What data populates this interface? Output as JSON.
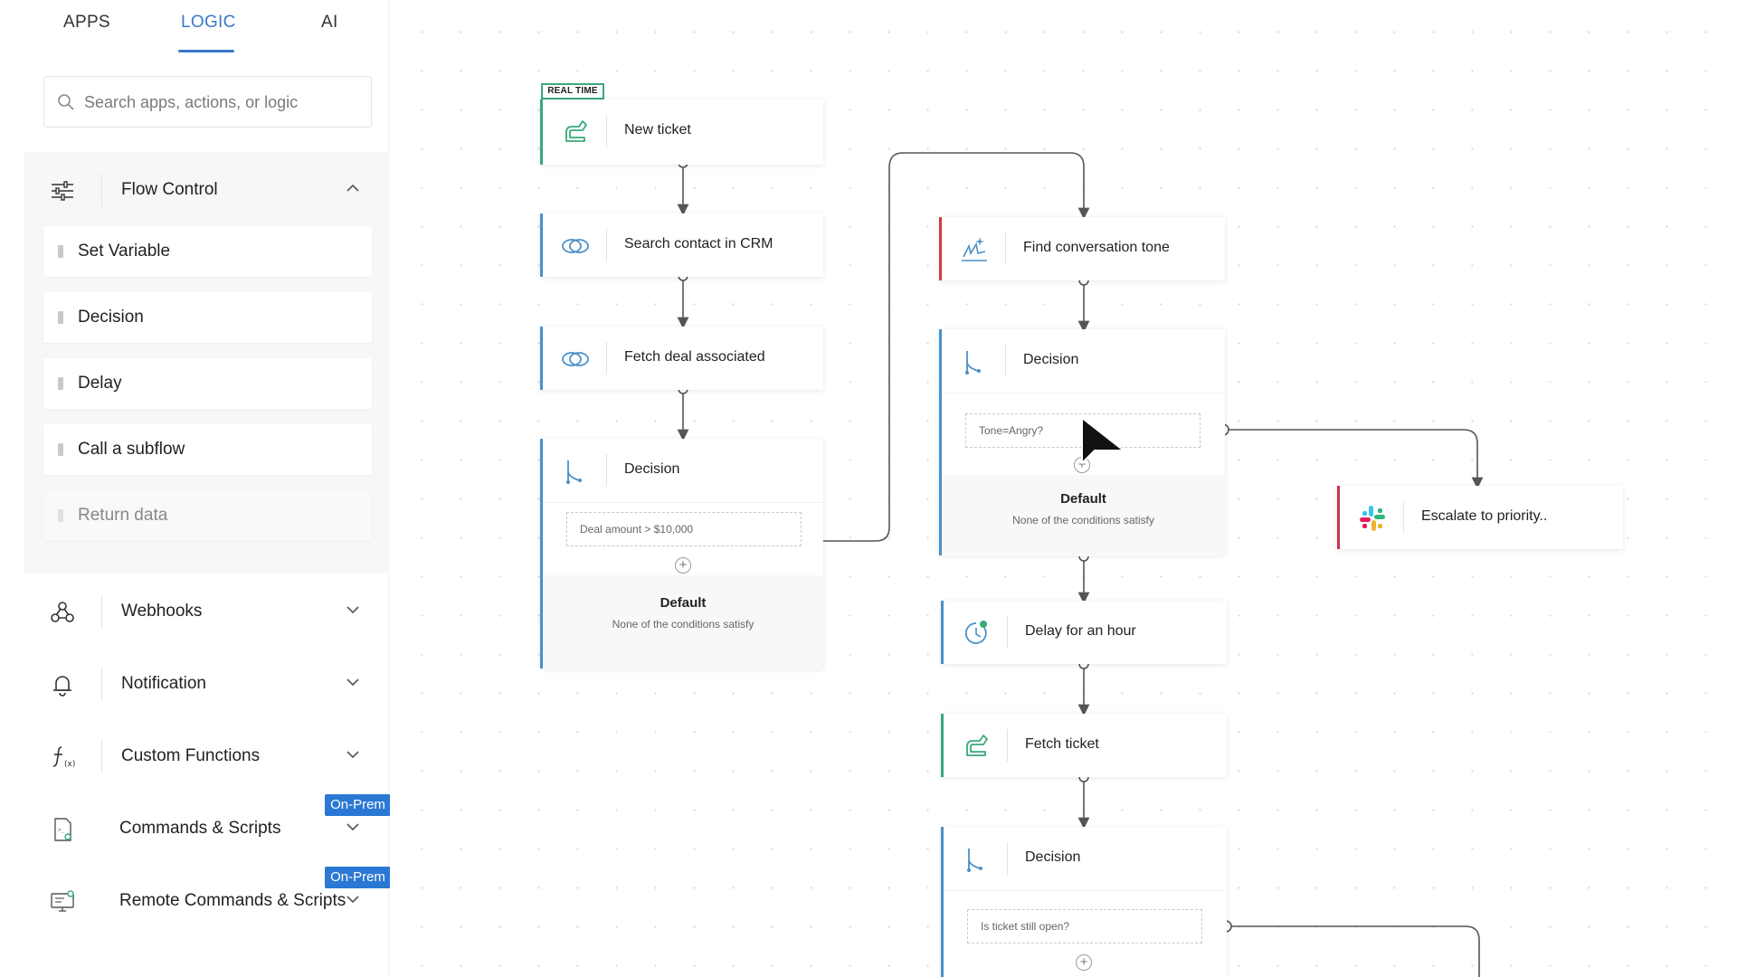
{
  "tabs": [
    {
      "label": "APPS",
      "active": false
    },
    {
      "label": "LOGIC",
      "active": true
    },
    {
      "label": "AI",
      "active": false
    }
  ],
  "search": {
    "placeholder": "Search apps, actions, or logic",
    "icon": "search-icon"
  },
  "categories": {
    "flow_control": {
      "label": "Flow Control",
      "icon": "sliders-icon",
      "expanded": true,
      "items": [
        "Set Variable",
        "Decision",
        "Delay",
        "Call a subflow",
        "Return data"
      ]
    },
    "webhooks": {
      "label": "Webhooks",
      "icon": "webhook-icon"
    },
    "notification": {
      "label": "Notification",
      "icon": "bell-icon"
    },
    "custom_functions": {
      "label": "Custom Functions",
      "icon": "function-icon"
    },
    "commands_scripts": {
      "label": "Commands & Scripts",
      "icon": "script-file-icon",
      "badge": "On-Prem"
    },
    "remote_commands": {
      "label": "Remote Commands & Scripts",
      "icon": "remote-monitor-icon",
      "badge": "On-Prem"
    }
  },
  "flow": {
    "realtime_tag": "REAL TIME",
    "left_column": {
      "new_ticket": "New ticket",
      "search_contact": "Search contact in CRM",
      "fetch_deal": "Fetch deal associated",
      "decision": {
        "title": "Decision",
        "condition": "Deal amount > $10,000",
        "default_title": "Default",
        "default_sub": "None of the conditions satisfy"
      }
    },
    "middle_column": {
      "find_tone": "Find conversation tone",
      "decision1": {
        "title": "Decision",
        "condition": "Tone=Angry?",
        "default_title": "Default",
        "default_sub": "None of the conditions satisfy"
      },
      "delay": "Delay for an hour",
      "fetch_ticket": "Fetch ticket",
      "decision2": {
        "title": "Decision",
        "condition": "Is ticket still open?"
      }
    },
    "right_column": {
      "escalate": "Escalate to priority.."
    }
  },
  "colors": {
    "accent_blue": "#3a78c9",
    "badge_blue": "#2a78d4",
    "trigger_green": "#39a97a",
    "ai_red": "#d23b3b",
    "slack_crimson": "#c8324b",
    "node_blue": "#4a90c8"
  }
}
